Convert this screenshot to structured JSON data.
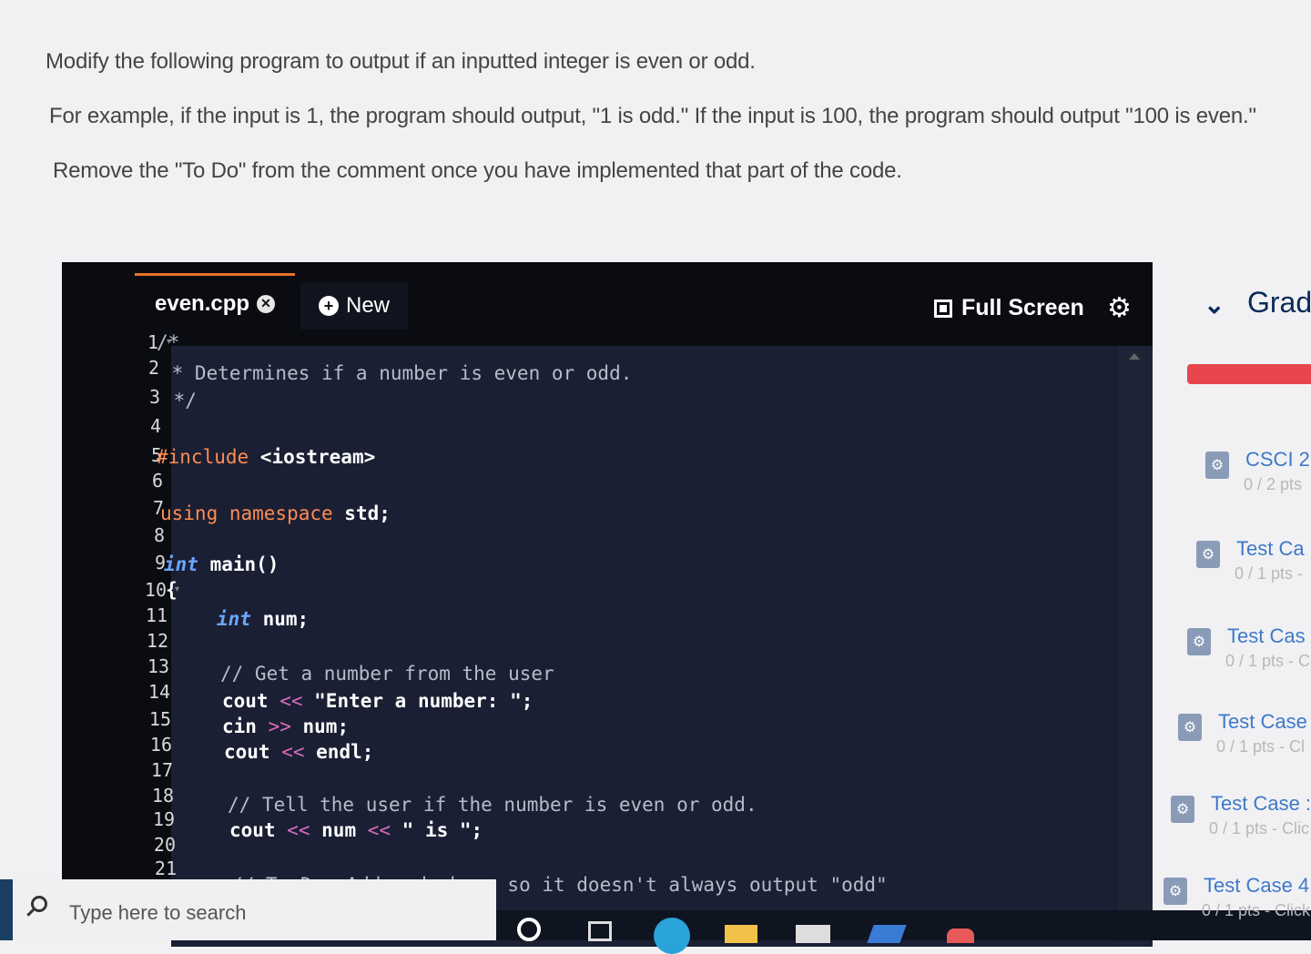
{
  "instructions": {
    "line1": "Modify the following program to output if an inputted integer is even or odd.",
    "line2": "For example, if the input is 1, the program should output, \"1 is odd.\" If the input is 100, the program should output \"100 is even.\"",
    "line3": "Remove the \"To Do\" from the comment once you have implemented that part of the code."
  },
  "editor": {
    "file_tab": "even.cpp",
    "new_tab": "New",
    "fullscreen_label": "Full Screen",
    "line_numbers": [
      "1",
      "2",
      "3",
      "4",
      "5",
      "6",
      "7",
      "8",
      "9",
      "10",
      "11",
      "12",
      "13",
      "14",
      "15",
      "16",
      "17",
      "18",
      "19",
      "20",
      "21"
    ],
    "code": {
      "l1": "/*",
      "l2": " * Determines if a number is even or odd.",
      "l3": " */",
      "l5_kw": "#include",
      "l5_rest": " <iostream>",
      "l7_kw": "using namespace",
      "l7_rest": " std;",
      "l9_ty": "int",
      "l9_rest": " main()",
      "l10": "{",
      "l11_ty": "int",
      "l11_rest": " num;",
      "l13": "// Get a number from the user",
      "l14_a": "cout",
      "l14_op": " << ",
      "l14_b": "\"Enter a number: \";",
      "l15_a": "cin",
      "l15_op": " >> ",
      "l15_b": "num;",
      "l16_a": "cout",
      "l16_op": " << ",
      "l16_b": "endl;",
      "l18": "// Tell the user if the number is even or odd.",
      "l19_a": "cout",
      "l19_op1": " << ",
      "l19_b": "num",
      "l19_op2": " << ",
      "l19_c": "\" is \";",
      "l21": "// To Do: Add code here so it doesn't always output \"odd\""
    }
  },
  "right_panel": {
    "heading": "Grad",
    "items": [
      {
        "title": "CSCI 2",
        "sub": "0 / 2 pts"
      },
      {
        "title": "Test Ca",
        "sub": "0 / 1 pts -"
      },
      {
        "title": "Test Cas",
        "sub": "0 / 1 pts - C"
      },
      {
        "title": "Test Case",
        "sub": "0 / 1 pts - Cl"
      },
      {
        "title": "Test Case :",
        "sub": "0 / 1 pts - Clic"
      },
      {
        "title": "Test Case 4",
        "sub": "0 / 1 pts - Click"
      }
    ]
  },
  "taskbar": {
    "search_placeholder": "Type here to search"
  },
  "colors": {
    "editor_bg": "#1a1f33",
    "tab_accent": "#e8742c",
    "keyword": "#ff8c52",
    "type": "#6aa6ff",
    "operator": "#d76bbd",
    "progress_fail": "#e8454d",
    "link": "#3f78c8"
  }
}
